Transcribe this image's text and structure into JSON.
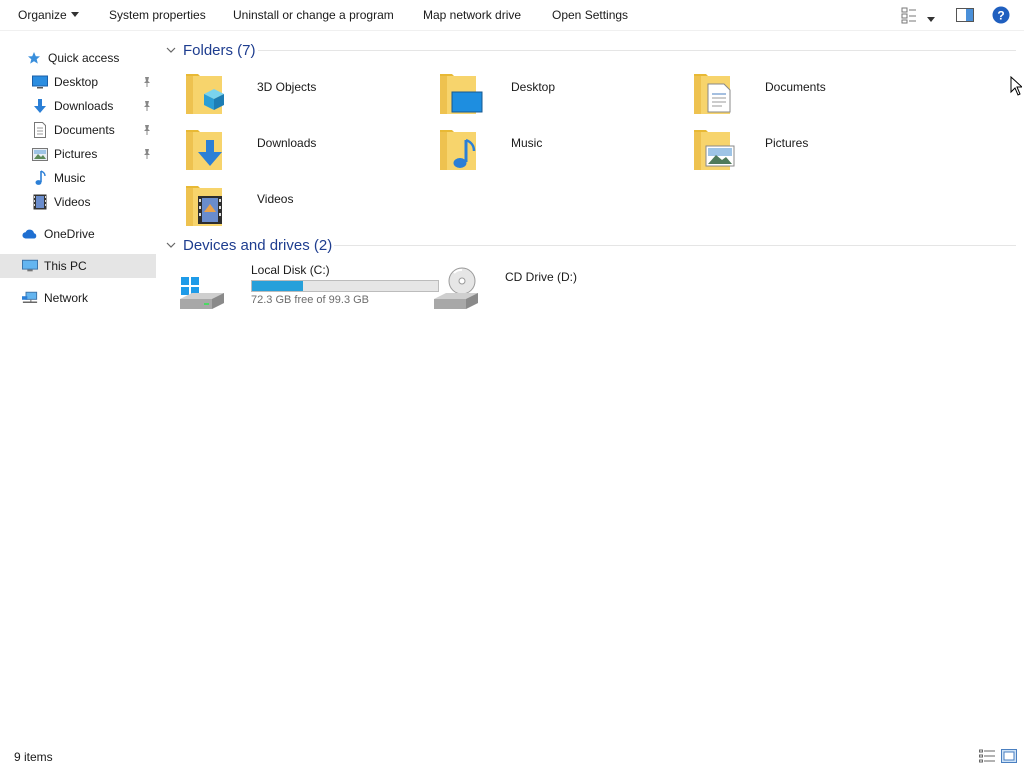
{
  "toolbar": {
    "organize": "Organize",
    "system_properties": "System properties",
    "uninstall": "Uninstall or change a program",
    "map_drive": "Map network drive",
    "open_settings": "Open Settings",
    "icons": [
      "view-options-icon",
      "dropdown-caret-icon",
      "preview-pane-icon",
      "help-icon"
    ]
  },
  "nav": {
    "quick_access": "Quick access",
    "items": [
      {
        "label": "Desktop",
        "icon": "desktop-icon",
        "pinned": true
      },
      {
        "label": "Downloads",
        "icon": "downloads-icon",
        "pinned": true
      },
      {
        "label": "Documents",
        "icon": "documents-icon",
        "pinned": true
      },
      {
        "label": "Pictures",
        "icon": "pictures-icon",
        "pinned": true
      },
      {
        "label": "Music",
        "icon": "music-icon",
        "pinned": false
      },
      {
        "label": "Videos",
        "icon": "videos-icon",
        "pinned": false
      }
    ],
    "onedrive": "OneDrive",
    "this_pc": "This PC",
    "network": "Network"
  },
  "folders": {
    "header": "Folders (7)",
    "items": [
      {
        "label": "3D Objects",
        "icon": "3d-objects-folder-icon"
      },
      {
        "label": "Desktop",
        "icon": "desktop-folder-icon"
      },
      {
        "label": "Documents",
        "icon": "documents-folder-icon"
      },
      {
        "label": "Downloads",
        "icon": "downloads-folder-icon"
      },
      {
        "label": "Music",
        "icon": "music-folder-icon"
      },
      {
        "label": "Pictures",
        "icon": "pictures-folder-icon"
      },
      {
        "label": "Videos",
        "icon": "videos-folder-icon"
      }
    ]
  },
  "devices": {
    "header": "Devices and drives (2)",
    "local_disk": {
      "label": "Local Disk (C:)",
      "free_text": "72.3 GB free of 99.3 GB",
      "used_fraction": 0.272
    },
    "cd_drive": {
      "label": "CD Drive (D:)"
    }
  },
  "status": {
    "items_count": "9 items"
  },
  "colors": {
    "accent": "#26a0da",
    "group_header": "#1e3d8f",
    "selection": "#e5e5e5",
    "folder": "#f7d46c"
  }
}
